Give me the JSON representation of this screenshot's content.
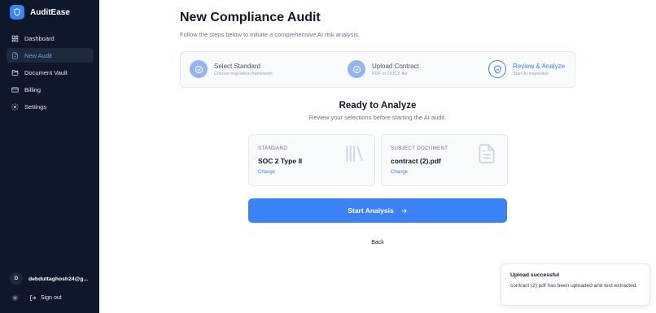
{
  "app": {
    "name": "AuditEase",
    "logo_icon": "shield-icon"
  },
  "sidebar": {
    "items": [
      {
        "label": "Dashboard",
        "icon": "dashboard-grid-icon",
        "active": false
      },
      {
        "label": "New Audit",
        "icon": "document-icon",
        "active": true
      },
      {
        "label": "Document Vault",
        "icon": "folder-icon",
        "active": false
      },
      {
        "label": "Billing",
        "icon": "credit-card-icon",
        "active": false
      },
      {
        "label": "Settings",
        "icon": "gear-icon",
        "active": false
      }
    ],
    "user": {
      "initial": "D",
      "email": "debduttaghosh24@g..."
    },
    "signout_label": "Sign out"
  },
  "page": {
    "title": "New Compliance Audit",
    "subtitle": "Follow the steps below to initiate a comprehensive AI risk analysis."
  },
  "steps": [
    {
      "title": "Select Standard",
      "desc": "Choose regulation framework",
      "state": "done"
    },
    {
      "title": "Upload Contract",
      "desc": "PDF or DOCX file",
      "state": "done"
    },
    {
      "title": "Review & Analyze",
      "desc": "Start AI inspection",
      "state": "current"
    }
  ],
  "review": {
    "title": "Ready to Analyze",
    "subtitle": "Review your selections before starting the AI audit.",
    "standard_card": {
      "label": "STANDARD",
      "value": "SOC 2 Type II",
      "change_label": "Change"
    },
    "document_card": {
      "label": "SUBJECT DOCUMENT",
      "value": "contract (2).pdf",
      "change_label": "Change"
    },
    "start_label": "Start Analysis",
    "back_label": "Back"
  },
  "toast": {
    "title": "Upload successful",
    "message": "contract (2).pdf has been uploaded and text extracted."
  },
  "colors": {
    "sidebar_bg": "#0f172a",
    "accent": "#3b82f6",
    "active_nav_text": "#60a5fa",
    "done_step": "#93b4f0"
  }
}
